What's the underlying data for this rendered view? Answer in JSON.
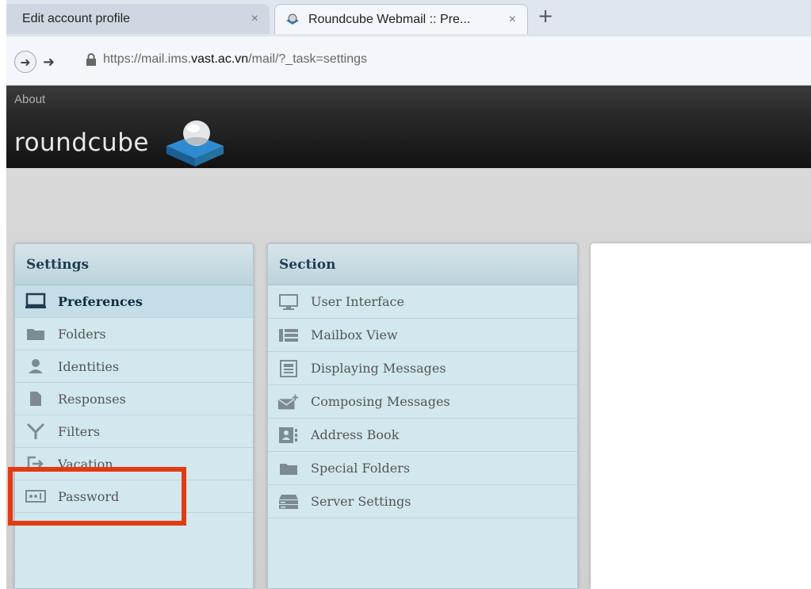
{
  "browser": {
    "tabs": [
      {
        "title": "Edit account profile",
        "close": "×"
      },
      {
        "title": "Roundcube Webmail :: Pre...",
        "close": "×"
      }
    ],
    "new_tab": "+",
    "url_prefix": "https://mail.ims.",
    "url_host": "vast.ac.vn",
    "url_path": "/mail/?_task=settings"
  },
  "header": {
    "about": "About",
    "logo_text": "roundcube"
  },
  "settings": {
    "title": "Settings",
    "items": [
      {
        "label": "Preferences",
        "icon": "monitor-icon"
      },
      {
        "label": "Folders",
        "icon": "folder-icon"
      },
      {
        "label": "Identities",
        "icon": "person-icon"
      },
      {
        "label": "Responses",
        "icon": "document-icon"
      },
      {
        "label": "Filters",
        "icon": "filter-icon"
      },
      {
        "label": "Vacation",
        "icon": "vacation-icon"
      },
      {
        "label": "Password",
        "icon": "password-icon"
      }
    ]
  },
  "section": {
    "title": "Section",
    "items": [
      {
        "label": "User Interface",
        "icon": "monitor-icon"
      },
      {
        "label": "Mailbox View",
        "icon": "list-icon"
      },
      {
        "label": "Displaying Messages",
        "icon": "message-icon"
      },
      {
        "label": "Composing Messages",
        "icon": "compose-icon"
      },
      {
        "label": "Address Book",
        "icon": "addressbook-icon"
      },
      {
        "label": "Special Folders",
        "icon": "folder-icon"
      },
      {
        "label": "Server Settings",
        "icon": "server-icon"
      }
    ]
  },
  "colors": {
    "highlight": "#e23b12",
    "panel": "#d3e7ee"
  }
}
